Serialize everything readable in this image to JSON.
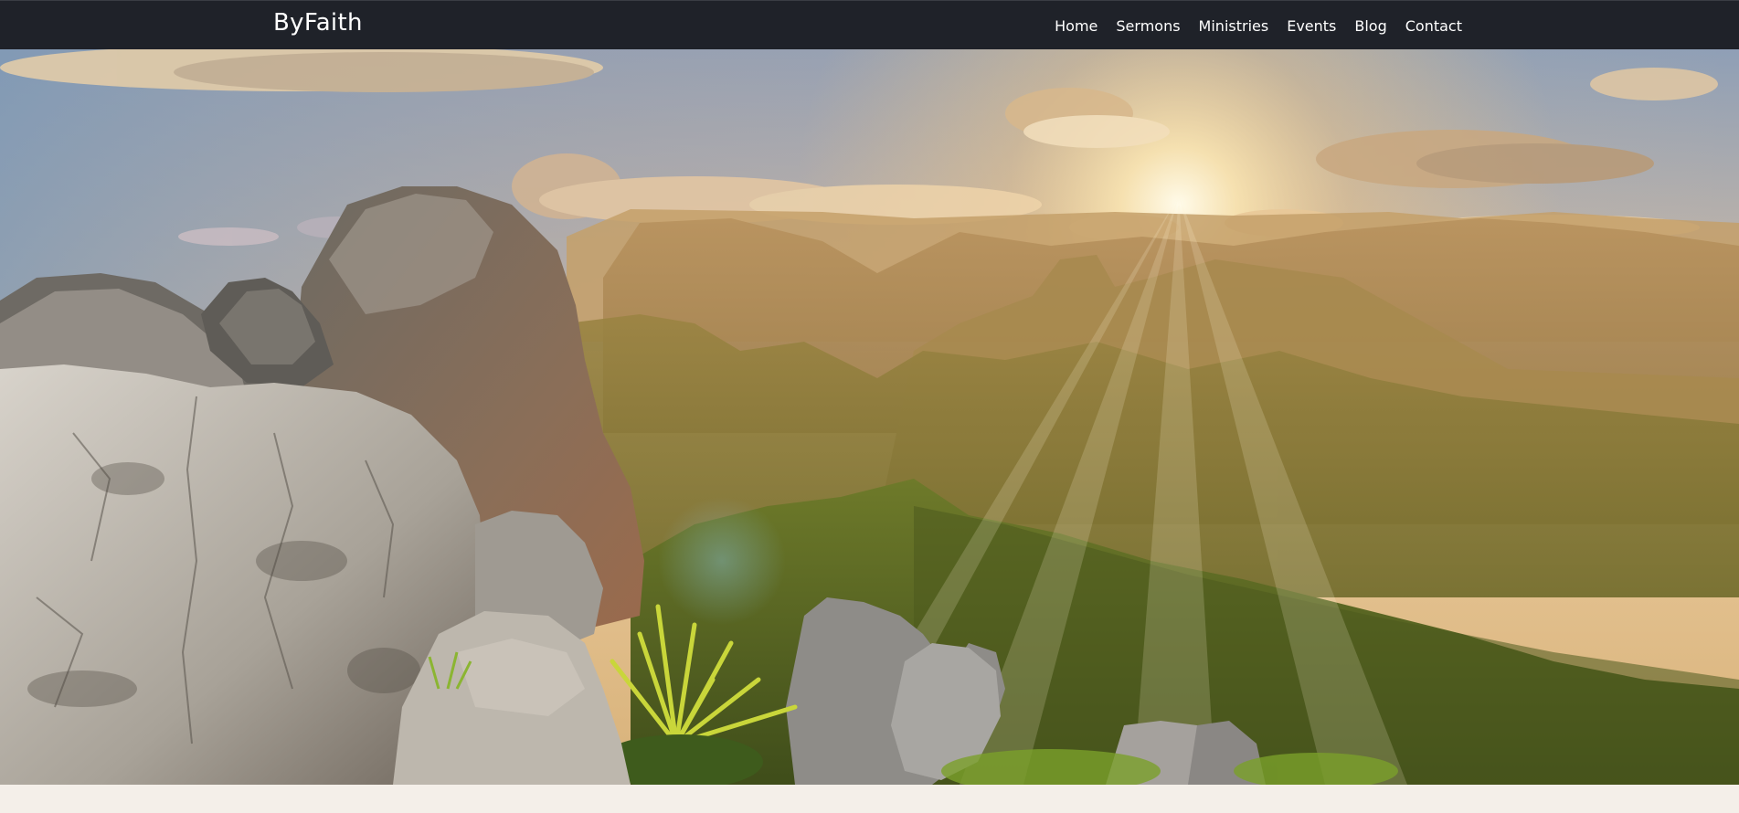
{
  "brand": {
    "name": "ByFaith"
  },
  "nav": {
    "items": [
      {
        "label": "Home"
      },
      {
        "label": "Sermons"
      },
      {
        "label": "Ministries"
      },
      {
        "label": "Events"
      },
      {
        "label": "Blog"
      },
      {
        "label": "Contact"
      }
    ]
  },
  "hero": {
    "image": "mountain-sunset-landscape"
  },
  "colors": {
    "navbar_bg": "#1f2229",
    "nav_text": "#ffffff",
    "page_bg": "#f4efe9"
  }
}
